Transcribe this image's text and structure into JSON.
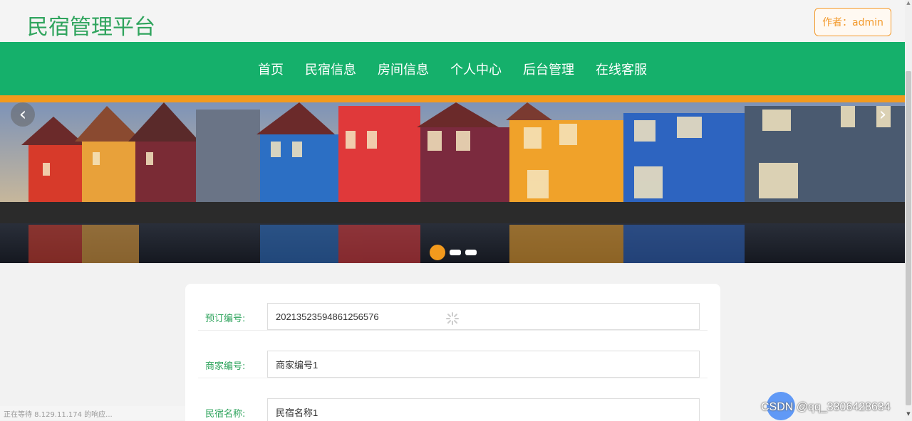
{
  "header": {
    "brand": "民宿管理平台",
    "author_button": "作者：admin"
  },
  "nav": {
    "items": [
      "首页",
      "民宿信息",
      "房间信息",
      "个人中心",
      "后台管理",
      "在线客服"
    ]
  },
  "banner": {
    "prev_icon": "chevron-left-icon",
    "next_icon": "chevron-right-icon",
    "slides_total": 3,
    "active_slide": 1
  },
  "form": {
    "fields": [
      {
        "label": "预订编号:",
        "value": "20213523594861256576"
      },
      {
        "label": "商家编号:",
        "value": "商家编号1"
      },
      {
        "label": "民宿名称:",
        "value": "民宿名称1"
      }
    ]
  },
  "status_bar": "正在等待 8.129.11.174 的响应...",
  "watermark": "CSDN @qq_3306428634",
  "colors": {
    "brand_green": "#15b06b",
    "accent_orange": "#f39a1d"
  }
}
